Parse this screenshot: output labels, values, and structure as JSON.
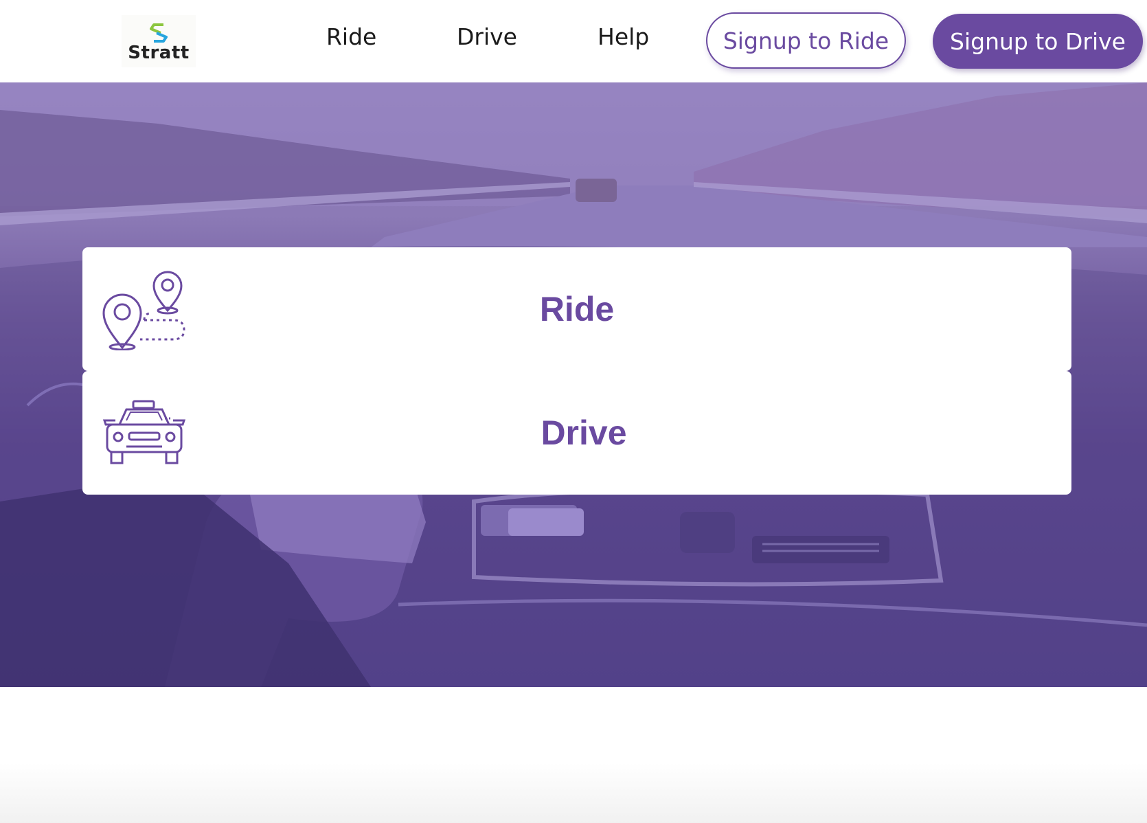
{
  "brand": {
    "logo_text": "Stratt",
    "logo_icon": "hexagon-s-logo-icon",
    "accent_color": "#6a4aa0"
  },
  "nav": {
    "links": [
      {
        "label": "Ride"
      },
      {
        "label": "Drive"
      },
      {
        "label": "Help"
      }
    ],
    "signup_ride_label": "Signup to Ride",
    "signup_drive_label": "Signup to Drive"
  },
  "hero": {
    "cards": [
      {
        "title": "Ride",
        "icon": "route-map-pins-icon"
      },
      {
        "title": "Drive",
        "icon": "taxi-car-icon"
      }
    ]
  }
}
